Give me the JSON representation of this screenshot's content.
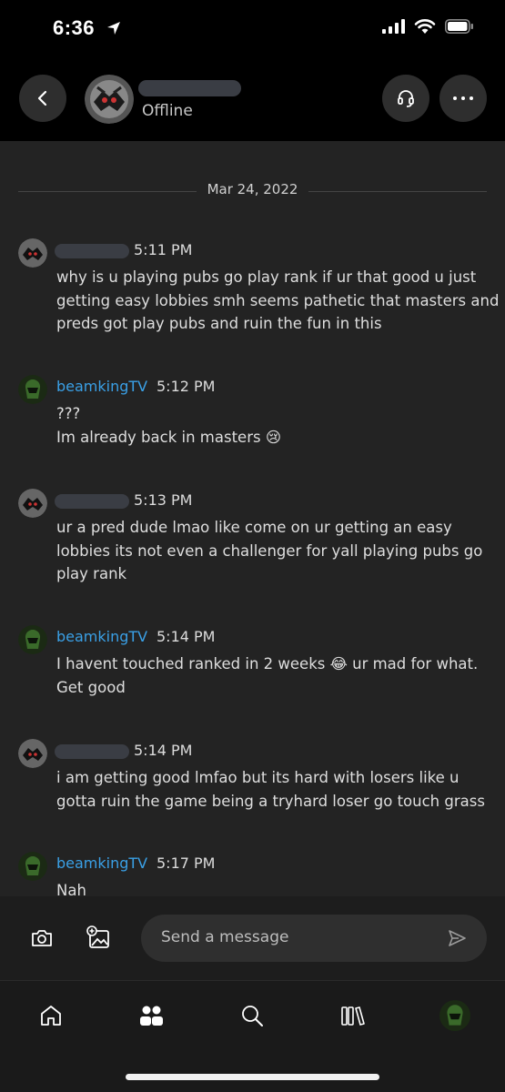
{
  "status_bar": {
    "time": "6:36"
  },
  "header": {
    "status": "Offline"
  },
  "chat": {
    "date": "Mar 24, 2022",
    "messages": [
      {
        "sender": "",
        "time": "5:11 PM",
        "lines": [
          "why is u playing pubs go play rank if ur that good u just",
          "getting easy lobbies smh seems pathetic that masters and",
          "preds got play pubs and ruin the fun in this"
        ]
      },
      {
        "sender": "beamkingTV",
        "time": "5:12 PM",
        "lines": [
          "???",
          "Im already back in masters 😢"
        ]
      },
      {
        "sender": "",
        "time": "5:13 PM",
        "lines": [
          "ur a pred dude lmao like come on ur getting an easy",
          "lobbies its not even a challenger for yall playing pubs go",
          "play rank"
        ]
      },
      {
        "sender": "beamkingTV",
        "time": "5:14 PM",
        "lines": [
          "I havent touched ranked in 2 weeks 😂 ur mad for what.",
          "Get good"
        ]
      },
      {
        "sender": "",
        "time": "5:14 PM",
        "lines": [
          "i am getting good lmfao but its hard with losers like u",
          "gotta ruin the game being a tryhard loser go touch grass"
        ]
      },
      {
        "sender": "beamkingTV",
        "time": "5:17 PM",
        "lines": [
          "Nah"
        ]
      }
    ]
  },
  "composer": {
    "placeholder": "Send a message"
  },
  "nav": {
    "items": [
      "home-icon",
      "social-icon",
      "search-icon",
      "library-icon",
      "profile-avatar"
    ]
  },
  "colors": {
    "accent": "#3aa0e6",
    "background": "#232323",
    "header": "#000000"
  }
}
